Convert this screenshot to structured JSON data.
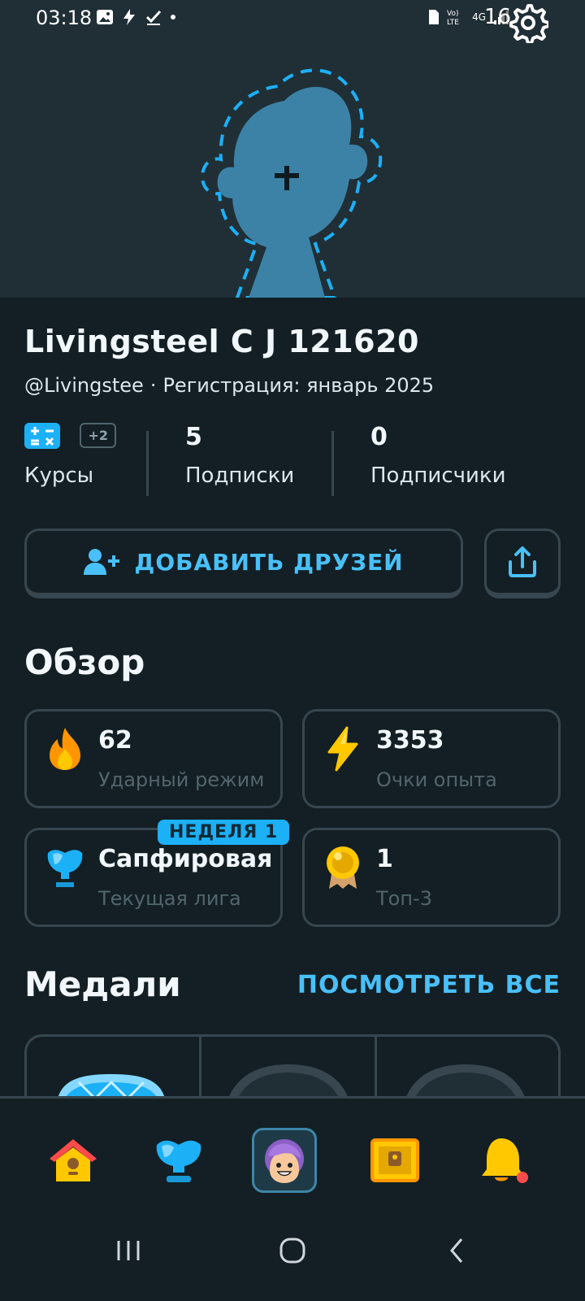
{
  "status_bar": {
    "time": "03:18",
    "icons": [
      "image-icon",
      "flash-icon",
      "check-icon",
      "dot-icon"
    ],
    "network": "4G",
    "battery": "16"
  },
  "profile": {
    "name": "Livingsteel C J 121620",
    "username": "@Livingstee",
    "separator": "·",
    "joined": "Регистрация: январь 2025"
  },
  "stats": {
    "courses_extra": "+2",
    "courses_label": "Курсы",
    "following_value": "5",
    "following_label": "Подписки",
    "followers_value": "0",
    "followers_label": "Подписчики"
  },
  "actions": {
    "add_friends": "ДОБАВИТЬ ДРУЗЕЙ"
  },
  "overview": {
    "title": "Обзор",
    "streak_value": "62",
    "streak_label": "Ударный режим",
    "xp_value": "3353",
    "xp_label": "Очки опыта",
    "league_badge": "НЕДЕЛЯ 1",
    "league_value": "Сапфировая",
    "league_label": "Текущая лига",
    "top3_value": "1",
    "top3_label": "Топ-3"
  },
  "medals": {
    "title": "Медали",
    "see_all": "ПОСМОТРЕТЬ ВСЕ"
  },
  "bottom_nav": {
    "items": [
      "home-icon",
      "league-icon",
      "profile-icon",
      "chest-icon",
      "notifications-icon"
    ],
    "active": "profile-icon"
  },
  "colors": {
    "background": "#131f24",
    "header": "#202f36",
    "accent_blue": "#1cb0f6",
    "link_blue": "#49c0f8",
    "border": "#37464f",
    "muted_text": "#52656d"
  }
}
